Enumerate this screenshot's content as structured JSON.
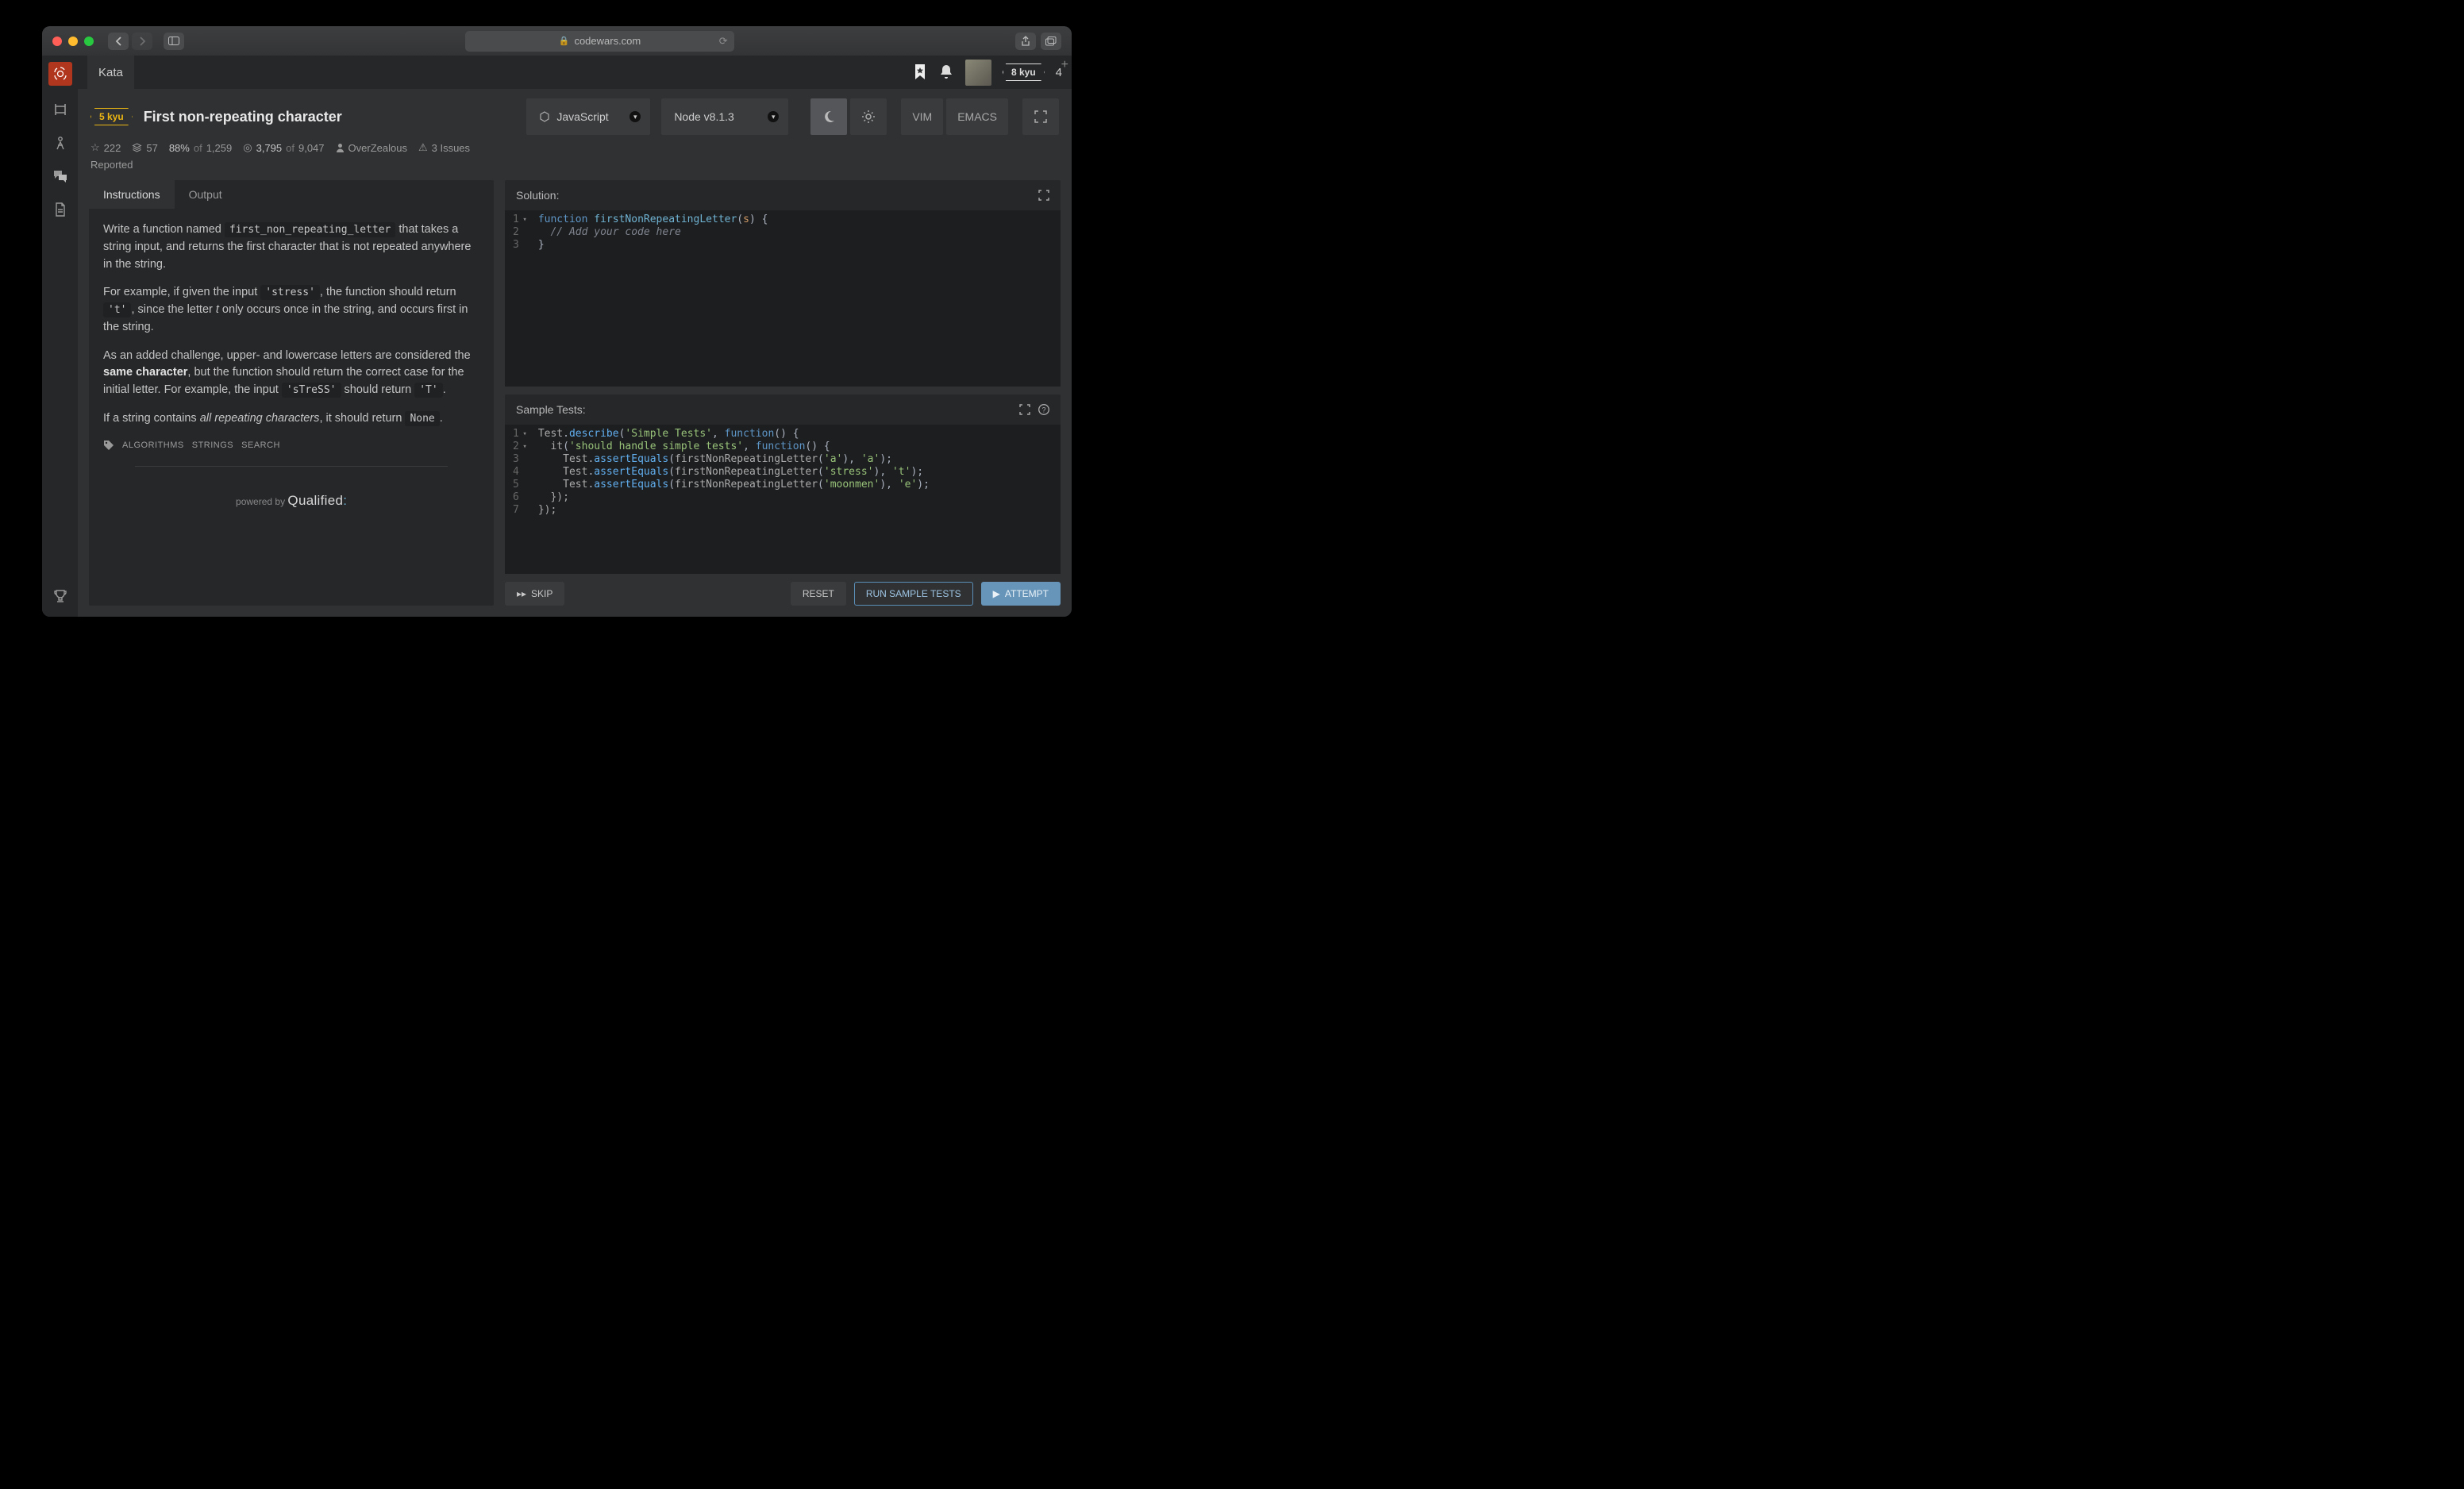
{
  "browser": {
    "url": "codewars.com"
  },
  "topbar": {
    "tab": "Kata",
    "user_kyu": "8 kyu",
    "honor": "4"
  },
  "kata": {
    "kyu": "5 kyu",
    "title": "First non-repeating character",
    "stars": "222",
    "collections": "57",
    "satisfaction_pct": "88%",
    "satisfaction_of": "of",
    "satisfaction_total": "1,259",
    "completed": "3,795",
    "completed_of": "of",
    "completed_total": "9,047",
    "author": "OverZealous",
    "issues": "3 Issues",
    "reported": "Reported",
    "language": "JavaScript",
    "node_version": "Node v8.1.3"
  },
  "toolbar": {
    "vim": "VIM",
    "emacs": "EMACS"
  },
  "panel_tabs": {
    "instructions": "Instructions",
    "output": "Output"
  },
  "desc": {
    "p1_a": "Write a function named ",
    "p1_code": "first_non_repeating_letter",
    "p1_b": " that takes a string input, and returns the first character that is not repeated anywhere in the string.",
    "p2_a": "For example, if given the input ",
    "p2_code1": "'stress'",
    "p2_b": ", the function should return ",
    "p2_code2": "'t'",
    "p2_c": ", since the letter ",
    "p2_em": "t",
    "p2_d": " only occurs once in the string, and occurs first in the string.",
    "p3_a": "As an added challenge, upper- and lowercase letters are considered the ",
    "p3_strong": "same character",
    "p3_b": ", but the function should return the correct case for the initial letter. For example, the input ",
    "p3_code1": "'sTreSS'",
    "p3_c": " should return ",
    "p3_code2": "'T'",
    "p3_d": ".",
    "p4_a": "If a string contains ",
    "p4_em": "all repeating characters",
    "p4_b": ", it should return ",
    "p4_code": "None",
    "p4_c": "."
  },
  "tags": [
    "ALGORITHMS",
    "STRINGS",
    "SEARCH"
  ],
  "powered": {
    "by": "powered by",
    "name": "Qualified"
  },
  "editors": {
    "solution_label": "Solution:",
    "tests_label": "Sample Tests:"
  },
  "solution": {
    "lines": [
      {
        "n": "1",
        "fold": true,
        "tokens": [
          [
            "kw",
            "function "
          ],
          [
            "fn",
            "firstNonRepeatingLetter"
          ],
          [
            "punct",
            "("
          ],
          [
            "param",
            "s"
          ],
          [
            "punct",
            ") {"
          ]
        ]
      },
      {
        "n": "2",
        "tokens": [
          [
            "plain",
            "  "
          ],
          [
            "comment",
            "// Add your code here"
          ]
        ]
      },
      {
        "n": "3",
        "tokens": [
          [
            "punct",
            "}"
          ]
        ]
      }
    ]
  },
  "tests": {
    "lines": [
      {
        "n": "1",
        "fold": true,
        "tokens": [
          [
            "plain",
            "Test"
          ],
          [
            "punct",
            "."
          ],
          [
            "method",
            "describe"
          ],
          [
            "punct",
            "("
          ],
          [
            "str",
            "'Simple Tests'"
          ],
          [
            "punct",
            ", "
          ],
          [
            "kw",
            "function"
          ],
          [
            "punct",
            "() {"
          ]
        ]
      },
      {
        "n": "2",
        "fold": true,
        "tokens": [
          [
            "plain",
            "  it"
          ],
          [
            "punct",
            "("
          ],
          [
            "str",
            "'should handle simple tests'"
          ],
          [
            "punct",
            ", "
          ],
          [
            "kw",
            "function"
          ],
          [
            "punct",
            "() {"
          ]
        ]
      },
      {
        "n": "3",
        "tokens": [
          [
            "plain",
            "    Test"
          ],
          [
            "punct",
            "."
          ],
          [
            "method",
            "assertEquals"
          ],
          [
            "punct",
            "("
          ],
          [
            "plain",
            "firstNonRepeatingLetter"
          ],
          [
            "punct",
            "("
          ],
          [
            "str",
            "'a'"
          ],
          [
            "punct",
            "), "
          ],
          [
            "str",
            "'a'"
          ],
          [
            "punct",
            ");"
          ]
        ]
      },
      {
        "n": "4",
        "tokens": [
          [
            "plain",
            "    Test"
          ],
          [
            "punct",
            "."
          ],
          [
            "method",
            "assertEquals"
          ],
          [
            "punct",
            "("
          ],
          [
            "plain",
            "firstNonRepeatingLetter"
          ],
          [
            "punct",
            "("
          ],
          [
            "str",
            "'stress'"
          ],
          [
            "punct",
            "), "
          ],
          [
            "str",
            "'t'"
          ],
          [
            "punct",
            ");"
          ]
        ]
      },
      {
        "n": "5",
        "tokens": [
          [
            "plain",
            "    Test"
          ],
          [
            "punct",
            "."
          ],
          [
            "method",
            "assertEquals"
          ],
          [
            "punct",
            "("
          ],
          [
            "plain",
            "firstNonRepeatingLetter"
          ],
          [
            "punct",
            "("
          ],
          [
            "str",
            "'moonmen'"
          ],
          [
            "punct",
            "), "
          ],
          [
            "str",
            "'e'"
          ],
          [
            "punct",
            ");"
          ]
        ]
      },
      {
        "n": "6",
        "tokens": [
          [
            "plain",
            "  });"
          ]
        ]
      },
      {
        "n": "7",
        "tokens": [
          [
            "plain",
            "});"
          ]
        ]
      }
    ]
  },
  "actions": {
    "skip": "SKIP",
    "reset": "RESET",
    "run": "RUN SAMPLE TESTS",
    "attempt": "ATTEMPT"
  }
}
